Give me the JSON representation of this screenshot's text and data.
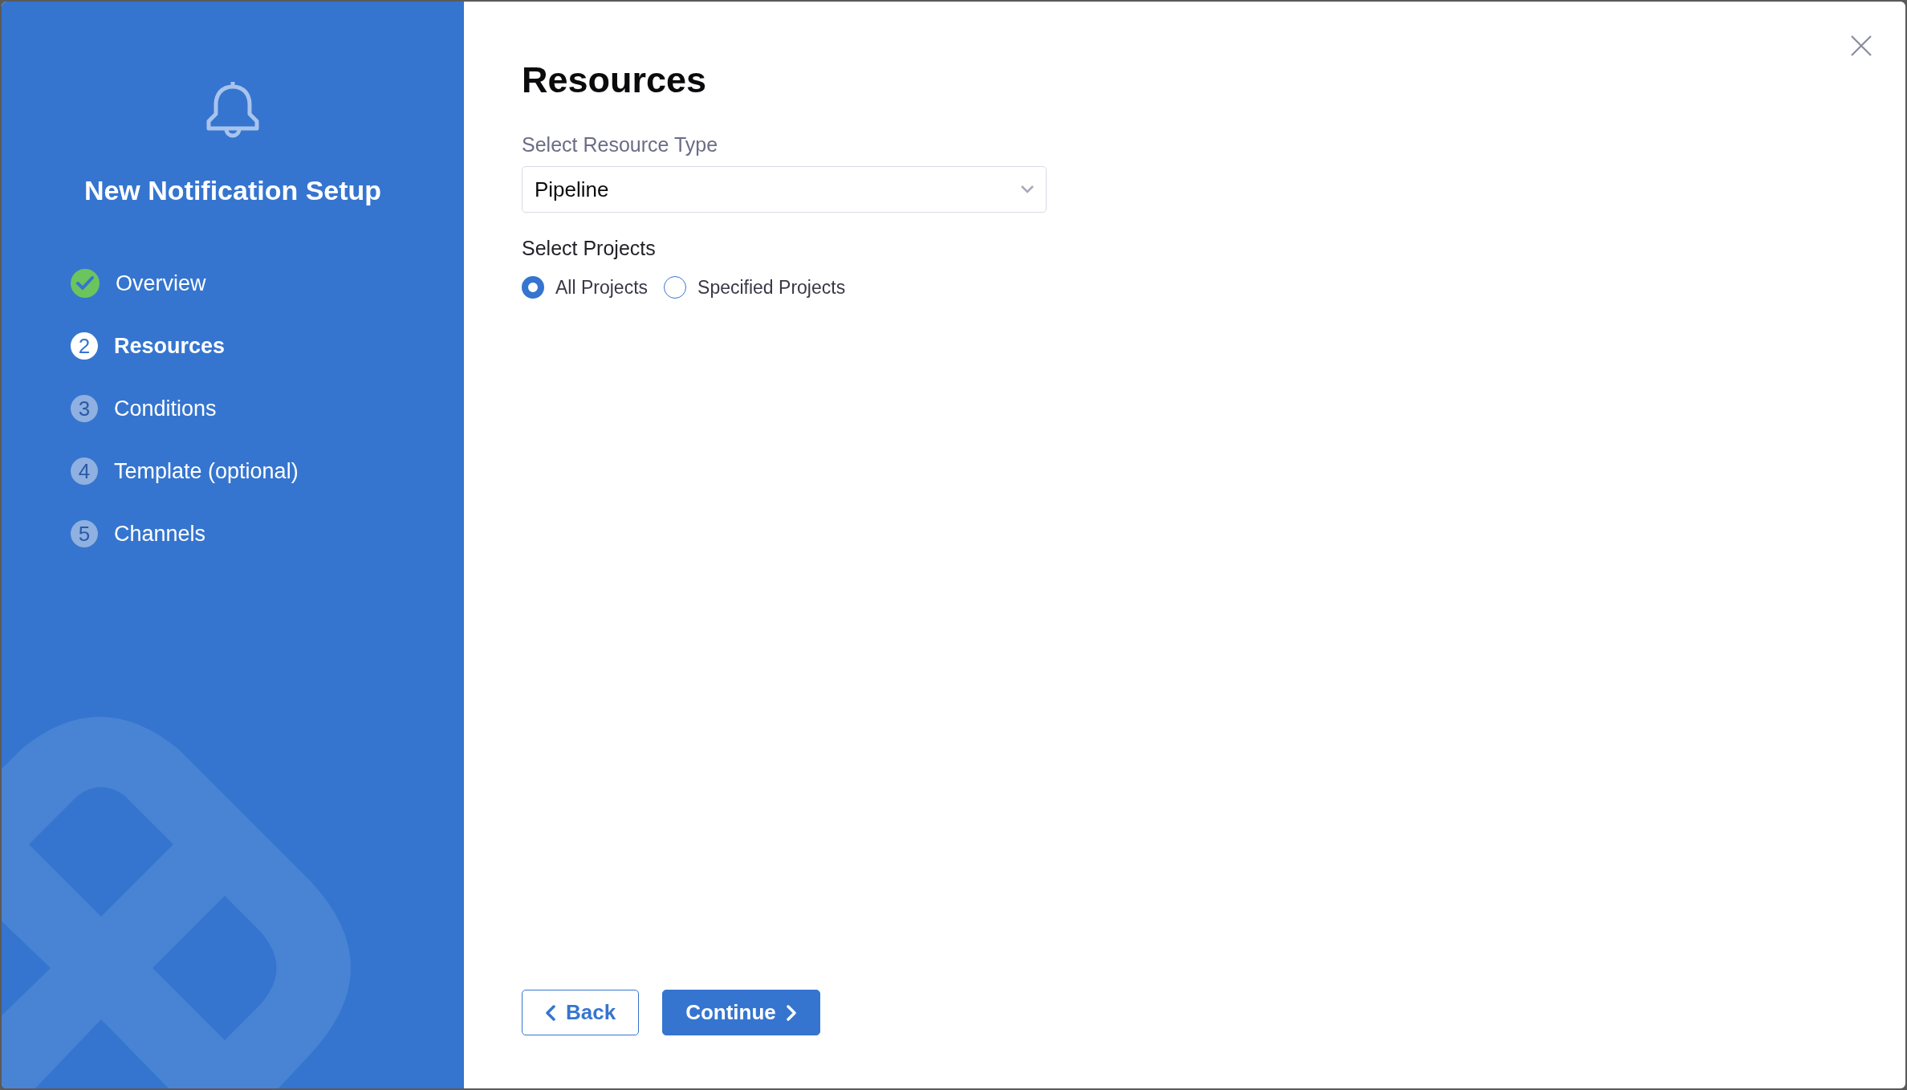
{
  "sidebar": {
    "title": "New Notification Setup",
    "steps": [
      {
        "kind": "check",
        "label": "Overview",
        "selected": false
      },
      {
        "kind": "number",
        "number": "2",
        "label": "Resources",
        "selected": true
      },
      {
        "kind": "number",
        "number": "3",
        "label": "Conditions",
        "selected": false
      },
      {
        "kind": "number",
        "number": "4",
        "label": "Template (optional)",
        "selected": false
      },
      {
        "kind": "number",
        "number": "5",
        "label": "Channels",
        "selected": false
      }
    ]
  },
  "main": {
    "heading": "Resources",
    "resource_type": {
      "label": "Select Resource Type",
      "value": "Pipeline"
    },
    "projects": {
      "label": "Select Projects",
      "options": [
        {
          "label": "All Projects",
          "selected": true
        },
        {
          "label": "Specified Projects",
          "selected": false
        }
      ]
    },
    "buttons": [
      {
        "kind": "back",
        "label": "Back"
      },
      {
        "kind": "continue",
        "label": "Continue"
      }
    ]
  }
}
